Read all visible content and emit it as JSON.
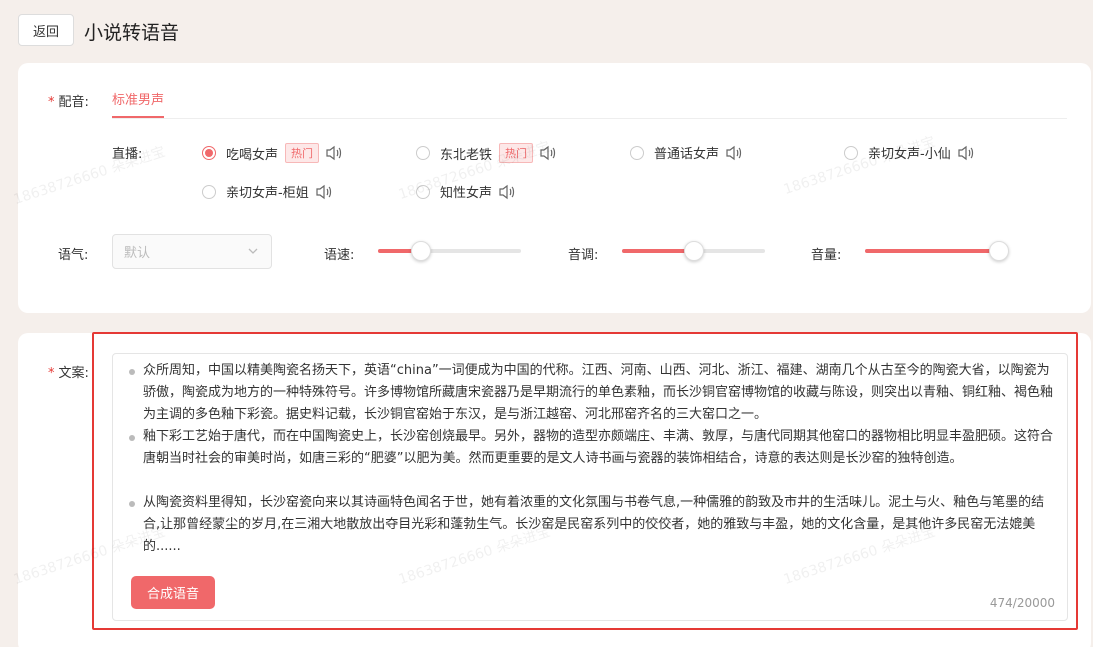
{
  "header": {
    "back_label": "返回",
    "title": "小说转语音"
  },
  "voice_section": {
    "label": "配音:",
    "active_tab": "标准男声",
    "row_label": "直播:",
    "hot_badge": "热门",
    "voices": [
      {
        "name": "吃喝女声",
        "hot": true,
        "checked": true
      },
      {
        "name": "东北老铁",
        "hot": true,
        "checked": false
      },
      {
        "name": "普通话女声",
        "hot": false,
        "checked": false
      },
      {
        "name": "亲切女声-小仙",
        "hot": false,
        "checked": false
      },
      {
        "name": "亲切女声-柜姐",
        "hot": false,
        "checked": false
      },
      {
        "name": "知性女声",
        "hot": false,
        "checked": false
      }
    ]
  },
  "controls": {
    "tone_label": "语气:",
    "tone_value": "默认",
    "speed_label": "语速:",
    "speed_value": 0.3,
    "pitch_label": "音调:",
    "pitch_value": 0.5,
    "volume_label": "音量:",
    "volume_value": 1.0
  },
  "content": {
    "label": "文案:",
    "paragraphs": [
      "众所周知，中国以精美陶瓷名扬天下，英语“china”一词便成为中国的代称。江西、河南、山西、河北、浙江、福建、湖南几个从古至今的陶瓷大省，以陶瓷为骄傲，陶瓷成为地方的一种特殊符号。许多博物馆所藏唐宋瓷器乃是早期流行的单色素釉，而长沙铜官窑博物馆的收藏与陈设，则突出以青釉、铜红釉、褐色釉为主调的多色釉下彩瓷。据史料记载，长沙铜官窑始于东汉，是与浙江越窑、河北邢窑齐名的三大窑口之一。",
      "釉下彩工艺始于唐代，而在中国陶瓷史上，长沙窑创烧最早。另外，器物的造型亦颇端庄、丰满、敦厚，与唐代同期其他窑口的器物相比明显丰盈肥硕。这符合唐朝当时社会的审美时尚，如唐三彩的“肥婆”以肥为美。然而更重要的是文人诗书画与瓷器的装饰相结合，诗意的表达则是长沙窑的独特创造。",
      "从陶瓷资料里得知，长沙窑瓷向来以其诗画特色闻名于世，她有着浓重的文化氛围与书卷气息,一种儒雅的韵致及市井的生活味儿。泥土与火、釉色与笔墨的结合,让那曾经蒙尘的岁月,在三湘大地散放出夺目光彩和蓬勃生气。长沙窑是民窑系列中的佼佼者，她的雅致与丰盈，她的文化含量，是其他许多民窑无法媲美的......"
    ],
    "submit_label": "合成语音",
    "char_count": "474/20000"
  },
  "watermark": "18638726660 朵朵进宝",
  "colors": {
    "accent": "#f0686a",
    "highlight_frame": "#e53935"
  }
}
